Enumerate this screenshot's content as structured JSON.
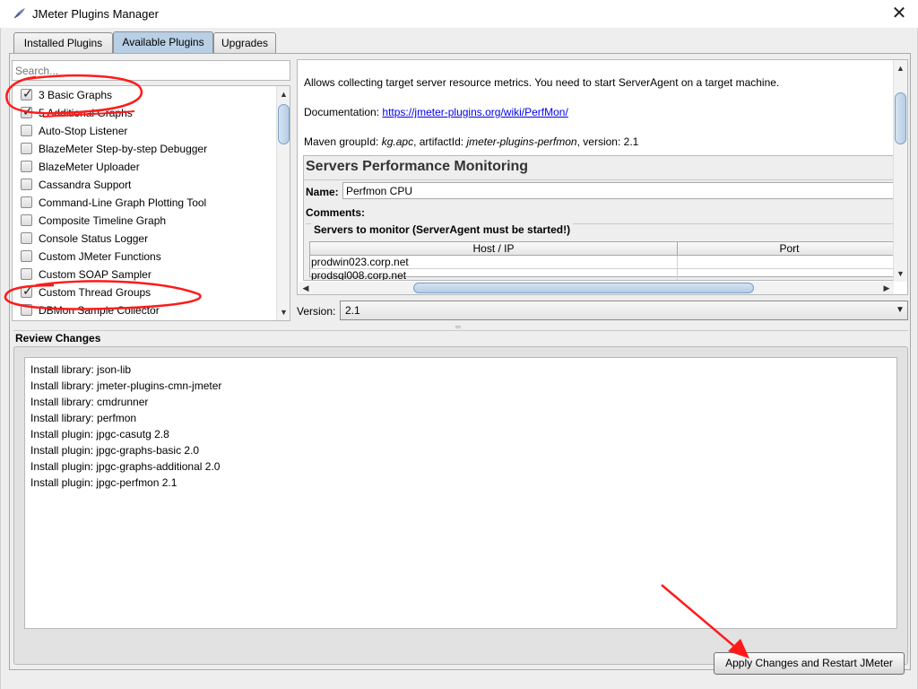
{
  "window": {
    "title": "JMeter Plugins Manager",
    "close_glyph": "✕",
    "app_icon": "jmeter-feather-icon"
  },
  "tabs": [
    {
      "label": "Installed Plugins",
      "active": false
    },
    {
      "label": "Available Plugins",
      "active": true
    },
    {
      "label": "Upgrades",
      "active": false
    }
  ],
  "search": {
    "placeholder": "Search..."
  },
  "plugins": [
    {
      "label": "3 Basic Graphs",
      "checked": true
    },
    {
      "label": "5 Additional Graphs",
      "checked": true
    },
    {
      "label": "Auto-Stop Listener",
      "checked": false
    },
    {
      "label": "BlazeMeter Step-by-step Debugger",
      "checked": false
    },
    {
      "label": "BlazeMeter Uploader",
      "checked": false
    },
    {
      "label": "Cassandra Support",
      "checked": false
    },
    {
      "label": "Command-Line Graph Plotting Tool",
      "checked": false
    },
    {
      "label": "Composite Timeline Graph",
      "checked": false
    },
    {
      "label": "Console Status Logger",
      "checked": false
    },
    {
      "label": "Custom JMeter Functions",
      "checked": false
    },
    {
      "label": "Custom SOAP Sampler",
      "checked": false
    },
    {
      "label": "Custom Thread Groups",
      "checked": true
    },
    {
      "label": "DBMon Sample Collector",
      "checked": false
    }
  ],
  "details": {
    "description": "Allows collecting target server resource metrics. You need to start ServerAgent on a target machine.",
    "doc_label": "Documentation: ",
    "doc_link": "https://jmeter-plugins.org/wiki/PerfMon/",
    "maven_prefix": "Maven groupId: ",
    "group_id": "kg.apc",
    "maven_mid": ", artifactId: ",
    "artifact_id": "jmeter-plugins-perfmon",
    "maven_version_prefix": ", version: ",
    "maven_version": "2.1"
  },
  "preview": {
    "title": "Servers Performance Monitoring",
    "name_label": "Name:",
    "name_value": "Perfmon CPU",
    "comments_label": "Comments:",
    "servers_title": "Servers to monitor (ServerAgent must be started!)",
    "columns": [
      "Host / IP",
      "Port"
    ],
    "rows": [
      "prodwin023.corp.net",
      "prodsql008.corp.net"
    ]
  },
  "version": {
    "label": "Version:",
    "value": "2.1"
  },
  "review": {
    "title": "Review Changes",
    "lines": [
      "Install library: json-lib",
      "Install library: jmeter-plugins-cmn-jmeter",
      "Install library: cmdrunner",
      "Install library: perfmon",
      "Install plugin: jpgc-casutg 2.8",
      "Install plugin: jpgc-graphs-basic 2.0",
      "Install plugin: jpgc-graphs-additional 2.0",
      "Install plugin: jpgc-perfmon 2.1"
    ]
  },
  "apply_button": "Apply Changes and Restart JMeter",
  "annotation_color": "#ff1a1a"
}
